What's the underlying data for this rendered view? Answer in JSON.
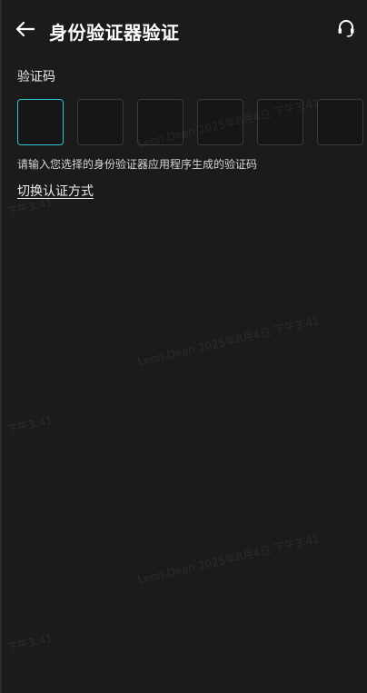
{
  "header": {
    "title": "身份验证器验证",
    "back_icon": "arrow-left-icon",
    "support_icon": "headset-icon"
  },
  "form": {
    "code_label": "验证码",
    "code_length": 6,
    "active_index": 0,
    "hint": "请输入您选择的身份验证器应用程序生成的验证码",
    "switch_link": "切换认证方式"
  },
  "watermark": {
    "full": "Leon Dean 2025年8月4日 下午3:41",
    "time": "下午3:41"
  },
  "colors": {
    "background": "#1b1b1b",
    "accent": "#2fc3cf",
    "box_border": "#3a3a3a"
  }
}
